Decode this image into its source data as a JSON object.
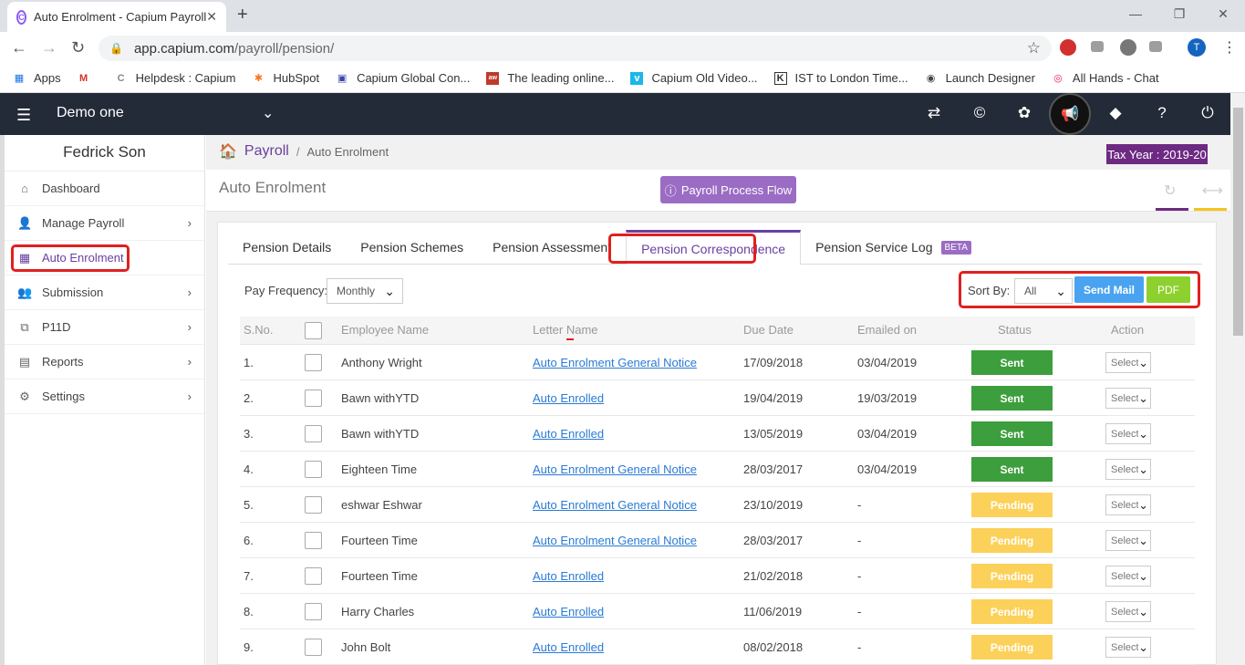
{
  "browser": {
    "tab_title": "Auto Enrolment - Capium Payroll",
    "url_host": "app.capium.com",
    "url_path": "/payroll/pension/",
    "profile_initial": "T",
    "bookmarks": [
      {
        "label": "Apps",
        "icon": "apps-grid-icon"
      },
      {
        "label": "",
        "icon": "gmail-icon"
      },
      {
        "label": "Helpdesk : Capium",
        "icon": "capium-icon"
      },
      {
        "label": "HubSpot",
        "icon": "hubspot-icon"
      },
      {
        "label": "Capium Global Con...",
        "icon": "capium-global-icon"
      },
      {
        "label": "The leading online...",
        "icon": "aw-icon"
      },
      {
        "label": "Capium Old Video...",
        "icon": "vimeo-icon"
      },
      {
        "label": "IST to London Time...",
        "icon": "clock-icon"
      },
      {
        "label": "Launch Designer",
        "icon": "designer-icon"
      },
      {
        "label": "All Hands - Chat",
        "icon": "chat-icon"
      }
    ]
  },
  "header": {
    "company": "Demo one"
  },
  "sidebar": {
    "user_name": "Fedrick Son",
    "items": [
      {
        "label": "Dashboard",
        "icon": "home-icon",
        "arrow": false
      },
      {
        "label": "Manage Payroll",
        "icon": "user-icon",
        "arrow": true
      },
      {
        "label": "Auto Enrolment",
        "icon": "grid-icon",
        "arrow": false,
        "active": true
      },
      {
        "label": "Submission",
        "icon": "users-icon",
        "arrow": true
      },
      {
        "label": "P11D",
        "icon": "copy-icon",
        "arrow": true
      },
      {
        "label": "Reports",
        "icon": "report-icon",
        "arrow": true
      },
      {
        "label": "Settings",
        "icon": "gear-icon",
        "arrow": true
      }
    ]
  },
  "breadcrumb": {
    "root": "Payroll",
    "leaf": "Auto Enrolment"
  },
  "tax_year": "Tax Year : 2019-20",
  "page_title": "Auto Enrolment",
  "process_flow_label": "Payroll Process Flow",
  "tabs": [
    {
      "label": "Pension Details"
    },
    {
      "label": "Pension Schemes"
    },
    {
      "label": "Pension Assessment"
    },
    {
      "label": "Pension Correspondence",
      "active": true
    },
    {
      "label": "Pension Service Log",
      "badge": "BETA"
    }
  ],
  "filters": {
    "pay_frequency_label": "Pay Frequency:",
    "pay_frequency_value": "Monthly",
    "sort_by_label": "Sort By:",
    "sort_by_value": "All",
    "send_mail_label": "Send Mail",
    "pdf_label": "PDF"
  },
  "table": {
    "headers": {
      "sno": "S.No.",
      "employee": "Employee Name",
      "letter": "Letter Name",
      "due": "Due Date",
      "emailed": "Emailed on",
      "status": "Status",
      "action": "Action"
    },
    "action_placeholder": "Select",
    "rows": [
      {
        "sno": "1.",
        "employee": "Anthony Wright",
        "letter": "Auto Enrolment General Notice",
        "due": "17/09/2018",
        "emailed": "03/04/2019",
        "status": "Sent"
      },
      {
        "sno": "2.",
        "employee": "Bawn withYTD",
        "letter": "Auto Enrolled",
        "due": "19/04/2019",
        "emailed": "19/03/2019",
        "status": "Sent"
      },
      {
        "sno": "3.",
        "employee": "Bawn withYTD",
        "letter": "Auto Enrolled",
        "due": "13/05/2019",
        "emailed": "03/04/2019",
        "status": "Sent"
      },
      {
        "sno": "4.",
        "employee": "Eighteen Time",
        "letter": "Auto Enrolment General Notice",
        "due": "28/03/2017",
        "emailed": "03/04/2019",
        "status": "Sent"
      },
      {
        "sno": "5.",
        "employee": "eshwar Eshwar",
        "letter": "Auto Enrolment General Notice",
        "due": "23/10/2019",
        "emailed": "-",
        "status": "Pending"
      },
      {
        "sno": "6.",
        "employee": "Fourteen Time",
        "letter": "Auto Enrolment General Notice",
        "due": "28/03/2017",
        "emailed": "-",
        "status": "Pending"
      },
      {
        "sno": "7.",
        "employee": "Fourteen Time",
        "letter": "Auto Enrolled",
        "due": "21/02/2018",
        "emailed": "-",
        "status": "Pending"
      },
      {
        "sno": "8.",
        "employee": "Harry Charles",
        "letter": "Auto Enrolled",
        "due": "11/06/2019",
        "emailed": "-",
        "status": "Pending"
      },
      {
        "sno": "9.",
        "employee": "John Bolt",
        "letter": "Auto Enrolled",
        "due": "08/02/2018",
        "emailed": "-",
        "status": "Pending"
      }
    ]
  },
  "colors": {
    "header_bg": "#232b38",
    "brand_purple": "#6d2a82",
    "sent_green": "#3d9e3d",
    "pending_yellow": "#fcd15a",
    "link_blue": "#2a7ad4",
    "highlight_red": "#e02020"
  }
}
